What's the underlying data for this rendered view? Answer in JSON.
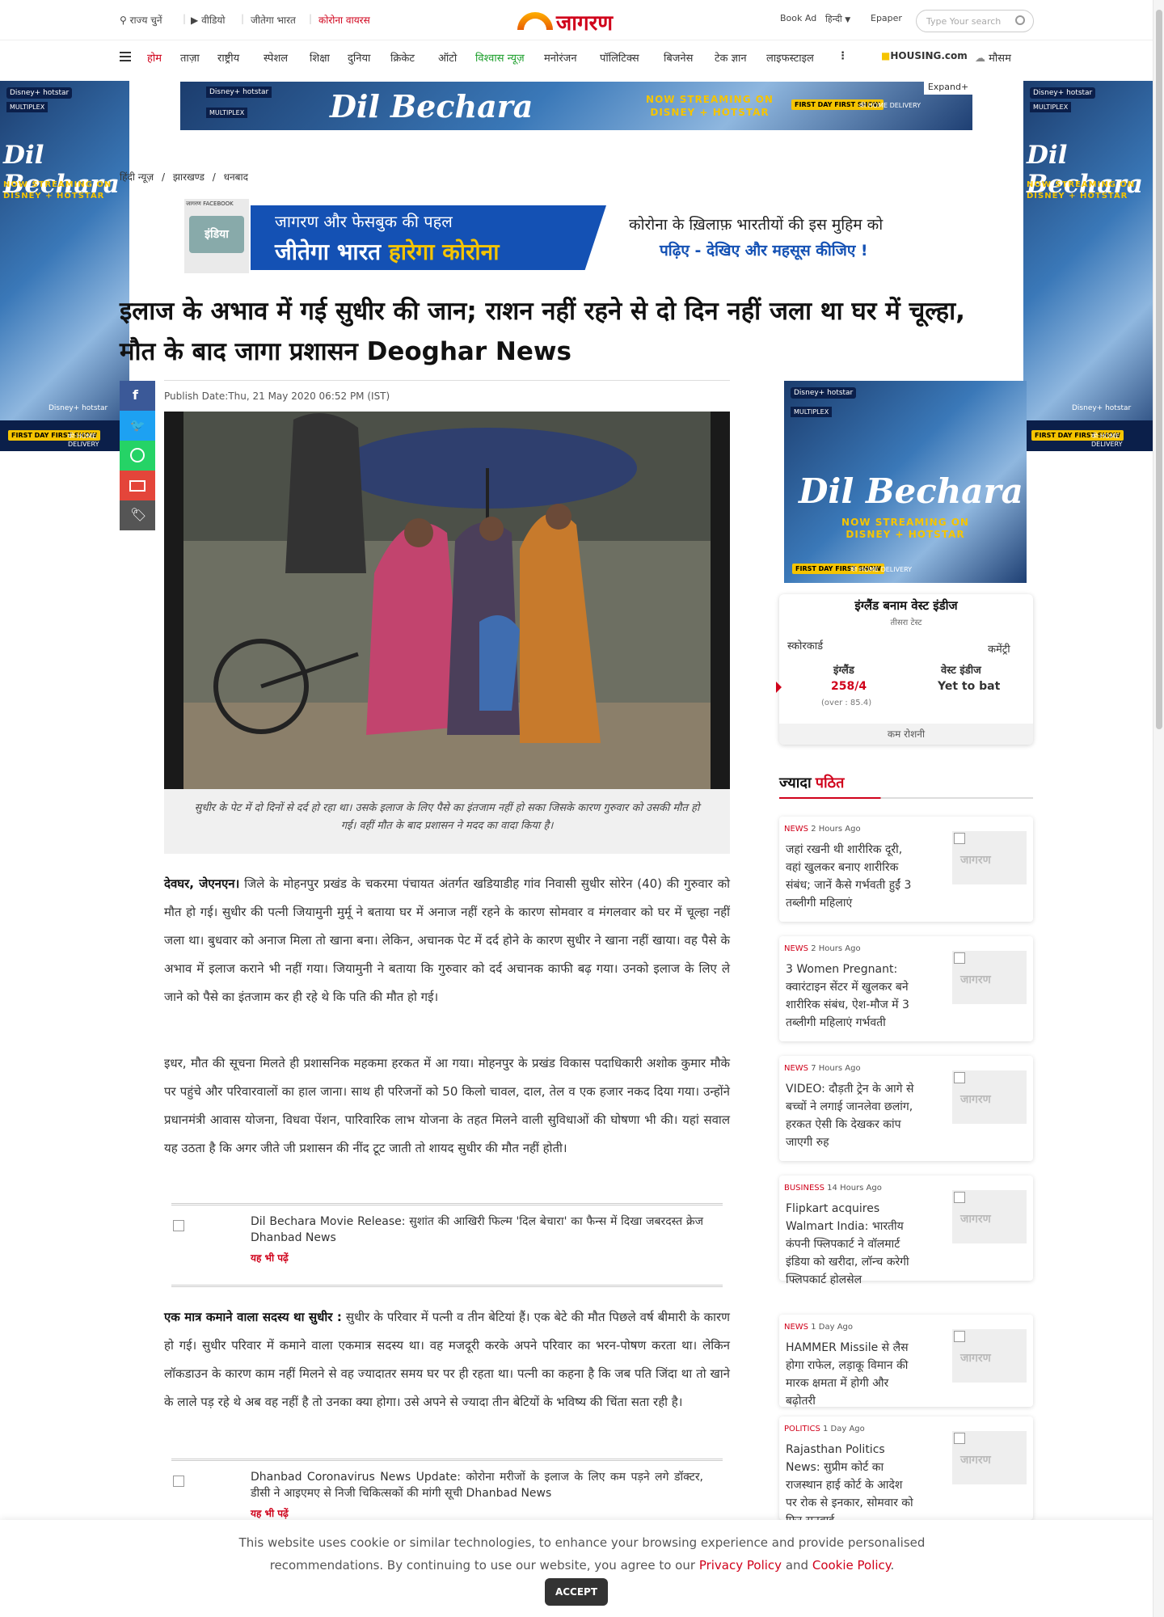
{
  "topbar": {
    "state": "राज्य चुनें",
    "video": "वीडियो",
    "campaign": "जीतेगा भारत",
    "corona": "कोरोना वायरस",
    "logo": "जागरण",
    "bookad": "Book Ad",
    "lang": "हिन्दी",
    "epaper": "Epaper",
    "search_placeholder": "Type Your search"
  },
  "nav": {
    "items": [
      "होम",
      "ताज़ा",
      "राष्ट्रीय",
      "स्पेशल",
      "शिक्षा",
      "दुनिया",
      "क्रिकेट",
      "ऑटो",
      "विश्वास न्यूज़",
      "मनोरंजन",
      "पॉलिटिक्स",
      "बिजनेस",
      "टेक ज्ञान",
      "लाइफस्टाइल"
    ],
    "housing": "HOUSING.com",
    "weather": "मौसम"
  },
  "ad": {
    "brand": "Disney+ hotstar",
    "multiplex": "MULTIPLEX",
    "title": "Dil Bechara",
    "streaming": "NOW STREAMING ON DISNEY + HOTSTAR",
    "firstday": "FIRST DAY FIRST SHOW",
    "home": "की HOME DELIVERY",
    "expand": "Expand+"
  },
  "breadcrumb": [
    "हिंदी न्यूज़",
    "झारखण्ड",
    "धनबाद"
  ],
  "pledge": {
    "tag": "जागरण FACEBOOK",
    "india": "इंडिया",
    "line1": "जागरण और फेसबुक की पहल",
    "line2a": "जीतेगा भारत",
    "line2b": "हारेगा कोरोना",
    "right1": "कोरोना के ख़िलाफ़ भारतीयों की इस मुहिम को",
    "right2": "पढ़िए - देखिए और महसूस कीजिए !"
  },
  "article": {
    "headline": "इलाज के अभाव में गई सुधीर की जान; राशन नहीं रहने से दो दिन नहीं जला था घर में चूल्हा, मौत के बाद जागा प्रशासन Deoghar News",
    "pubdate": "Publish Date:Thu, 21 May 2020 06:52 PM (IST)",
    "caption": "सुधीर के पेट में दो दिनों से दर्द हो रहा था। उसके इलाज के लिए पैसे का इंतजाम नहीं हो सका जिसके कारण गुरुवार को उसकी मौत हो गई। वहीं मौत के बाद प्रशासन ने मदद का वादा किया है।",
    "p1_lead": "देवघर, जेएनएन।",
    "p1": " जिले के मोहनपुर प्रखंड के चकरमा पंचायत अंतर्गत खडियाडीह गांव निवासी सुधीर सोरेन (40) की गुरुवार को मौत हो गई। सुधीर की पत्नी जियामुनी मुर्मू ने बताया घर में अनाज नहीं रहने के कारण सोमवार व मंगलवार को घर में चूल्हा नहीं जला था। बुधवार को अनाज मिला तो खाना बना। लेकिन, अचानक पेट में दर्द होने के कारण सुधीर ने खाना नहीं खाया। वह पैसे के अभाव में इलाज कराने भी नहीं गया। जियामुनी ने बताया कि गुरुवार को दर्द अचानक काफी बढ़ गया। उनको इलाज के लिए ले जाने को पैसे का इंतजाम कर ही रहे थे कि पति की मौत हो गई।",
    "p2": "इधर, मौत की सूचना मिलते ही प्रशासनिक महकमा हरकत में आ गया। मोहनपुर के प्रखंड विकास पदाधिकारी अशोक कुमार मौके पर पहुंचे और परिवारवालों का हाल जाना। साथ ही परिजनों को 50 किलो चावल, दाल, तेल व एक हजार नकद दिया गया। उन्होंने प्रधानमंत्री आवास योजना, विधवा पेंशन, पारिवारिक लाभ योजना के तहत मिलने वाली सुविधाओं की घोषणा भी की। यहां सवाल यह उठता है कि अगर जीते जी प्रशासन की नींद टूट जाती तो शायद सुधीर की मौत नहीं होती।",
    "p3_lead": "एक मात्र कमाने वाला सदस्य था सुधीर :",
    "p3": " सुधीर के परिवार में पत्नी व तीन बेटियां हैं। एक बेटे की मौत पिछले वर्ष बीमारी के कारण हो गई। सुधीर परिवार में कमाने वाला एकमात्र सदस्य था। वह मजदूरी करके अपने परिवार का भरन-पोषण करता था। लेकिन लॉकडाउन के कारण काम नहीं मिलने से वह ज्यादातर समय घर पर ही रहता था। पत्नी का कहना है कि जब पति जिंदा था तो खाने के लाले पड़ रहे थे अब वह नहीं है तो उनका क्या होगा। उसे अपने से ज्यादा तीन बेटियों के भविष्य की चिंता सता रही है।",
    "related": [
      {
        "text": "Dil Bechara Movie Release: सुशांत की आखिरी फिल्म 'दिल बेचारा' का फैन्स में दिखा जबरदस्त क्रेज Dhanbad News",
        "more": "यह भी पढ़ें"
      },
      {
        "text": "Dhanbad Coronavirus News Update: कोरोना मरीजों के इलाज के लिए कम पड़ने लगे डॉक्टर, डीसी ने आइएमए से निजी चिकित्सकों की मांगी सूची Dhanbad News",
        "more": "यह भी पढ़ें"
      }
    ]
  },
  "score": {
    "title": "इंग्लैंड बनाम वेस्ट इंडीज",
    "sub": "तीसरा टेस्ट",
    "tab1": "स्कोरकार्ड",
    "tab2": "कमेंट्री",
    "team1": "इंग्लैंड",
    "score1": "258/4",
    "overs": "(over : 85.4)",
    "team2": "वेस्ट इंडीज",
    "score2": "Yet to bat",
    "status": "कम रोशनी"
  },
  "popular": {
    "title_a": "ज्यादा",
    "title_b": "पठित",
    "logo": "जागरण",
    "items": [
      {
        "cat": "NEWS",
        "time": "2 Hours Ago",
        "title": "जहां रखनी थी शारीरिक दूरी, वहां खुलकर बनाए शारीरिक संबंध; जानें कैसे गर्भवती हुईं 3 तब्लीगी महिलाएं"
      },
      {
        "cat": "NEWS",
        "time": "2 Hours Ago",
        "title": "3 Women Pregnant: क्वारंटाइन सेंटर में खुलकर बने शारीरिक संबंध, ऐश-मौज में 3 तब्लीगी महिलाएं गर्भवती"
      },
      {
        "cat": "NEWS",
        "time": "7 Hours Ago",
        "title": "VIDEO: दौड़ती ट्रेन के आगे से बच्चों ने लगाई जानलेवा छलांग, हरकत ऐसी कि देखकर कांप जाएगी रुह"
      },
      {
        "cat": "BUSINESS",
        "time": "14 Hours Ago",
        "title": "Flipkart acquires Walmart India: भारतीय कंपनी फ्लिपकार्ट ने वॉलमार्ट इंडिया को खरीदा, लॉन्च करेगी फ्लिपकार्ट होलसेल"
      },
      {
        "cat": "NEWS",
        "time": "1 Day Ago",
        "title": "HAMMER Missile से लैस होगा राफेल, लड़ाकू विमान की मारक क्षमता में होगी और बढ़ोतरी"
      },
      {
        "cat": "POLITICS",
        "time": "1 Day Ago",
        "title": "Rajasthan Politics News: सुप्रीम कोर्ट का राजस्थान हाई कोर्ट के आदेश पर रोक से इनकार, सोमवार को फिर सनवाई"
      }
    ]
  },
  "cookie": {
    "line1": "This website uses cookie or similar technologies, to enhance your browsing experience and provide personalised",
    "line2a": "recommendations. By continuing to use our website, you agree to our",
    "privacy": "Privacy Policy",
    "and": "and",
    "cookie_policy": "Cookie Policy",
    "accept": "ACCEPT"
  }
}
